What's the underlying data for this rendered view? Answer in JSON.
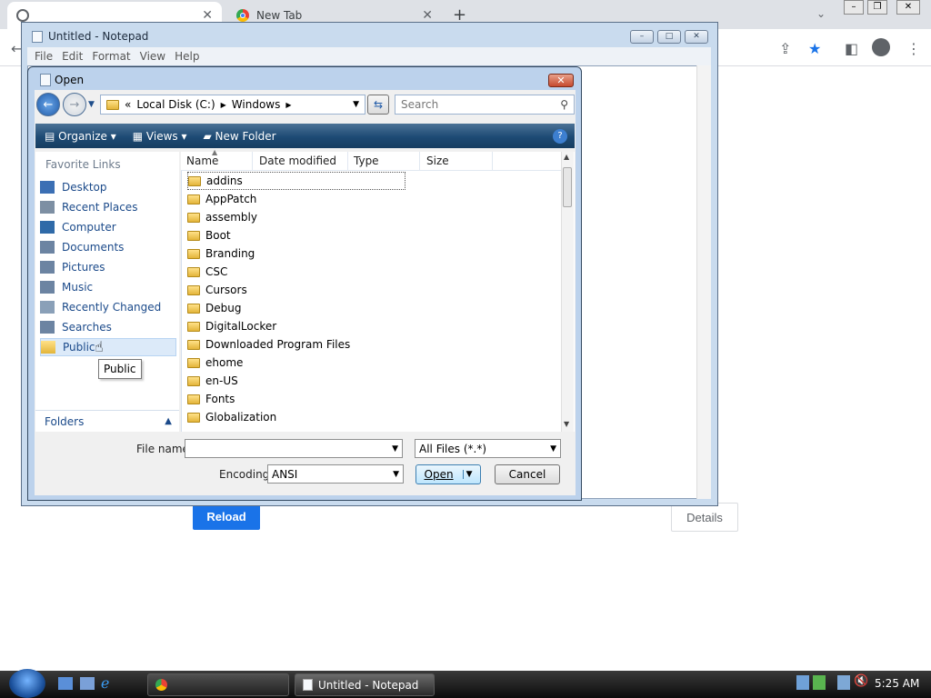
{
  "browser": {
    "tabs": [
      {
        "title": "",
        "close": "✕"
      },
      {
        "title": "New Tab",
        "close": "✕"
      }
    ],
    "new_tab": "+",
    "reload_label": "Reload",
    "details_label": "Details"
  },
  "notepad": {
    "title": "Untitled - Notepad",
    "menu": [
      "File",
      "Edit",
      "Format",
      "View",
      "Help"
    ]
  },
  "dialog": {
    "title": "Open",
    "close": "✕",
    "address": {
      "sep": "«",
      "parts": [
        "Local Disk (C:)",
        "Windows"
      ]
    },
    "search_placeholder": "Search",
    "toolbar": {
      "organize": "Organize",
      "views": "Views",
      "new_folder": "New Folder",
      "help": "?"
    },
    "favorite_links_header": "Favorite Links",
    "favorite_links": [
      "Desktop",
      "Recent Places",
      "Computer",
      "Documents",
      "Pictures",
      "Music",
      "Recently Changed",
      "Searches",
      "Public"
    ],
    "folders_label": "Folders",
    "columns": [
      "Name",
      "Date modified",
      "Type",
      "Size"
    ],
    "files": [
      "addins",
      "AppPatch",
      "assembly",
      "Boot",
      "Branding",
      "CSC",
      "Cursors",
      "Debug",
      "DigitalLocker",
      "Downloaded Program Files",
      "ehome",
      "en-US",
      "Fonts",
      "Globalization"
    ],
    "tooltip": "Public",
    "file_name_label": "File name:",
    "file_name_value": "",
    "filetype_value": "All Files  (*.*)",
    "encoding_label": "Encoding:",
    "encoding_value": "ANSI",
    "open_label": "Open",
    "cancel_label": "Cancel"
  },
  "taskbar": {
    "tasks": [
      "",
      "Untitled - Notepad"
    ],
    "clock": "5:25 AM"
  }
}
